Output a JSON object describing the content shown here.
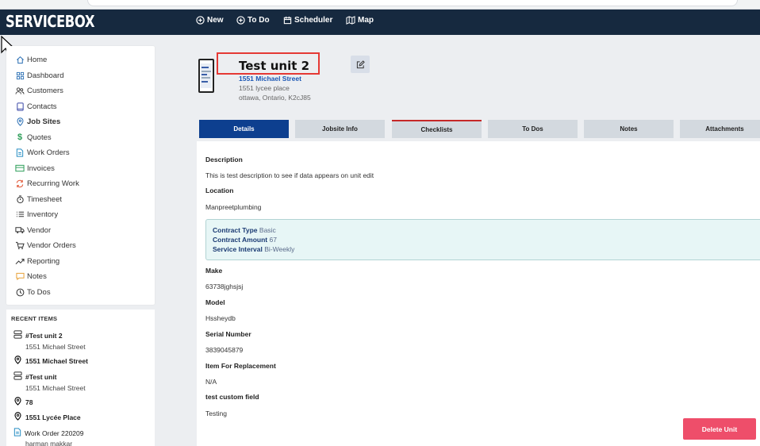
{
  "app": {
    "logo": "SERVICEBOX"
  },
  "nav": [
    {
      "label": "New",
      "icon": "plus-circle-icon"
    },
    {
      "label": "To Do",
      "icon": "plus-circle-icon"
    },
    {
      "label": "Scheduler",
      "icon": "calendar-icon"
    },
    {
      "label": "Map",
      "icon": "map-icon"
    }
  ],
  "sidebar": {
    "items": [
      {
        "label": "Home",
        "icon": "home-icon"
      },
      {
        "label": "Dashboard",
        "icon": "grid-icon"
      },
      {
        "label": "Customers",
        "icon": "users-icon"
      },
      {
        "label": "Contacts",
        "icon": "contact-book-icon"
      },
      {
        "label": "Job Sites",
        "icon": "location-pin-icon"
      },
      {
        "label": "Quotes",
        "icon": "dollar-icon"
      },
      {
        "label": "Work Orders",
        "icon": "document-icon"
      },
      {
        "label": "Invoices",
        "icon": "invoice-icon"
      },
      {
        "label": "Recurring Work",
        "icon": "recurring-icon"
      },
      {
        "label": "Timesheet",
        "icon": "stopwatch-icon"
      },
      {
        "label": "Inventory",
        "icon": "list-icon"
      },
      {
        "label": "Vendor",
        "icon": "truck-icon"
      },
      {
        "label": "Vendor Orders",
        "icon": "cart-icon"
      },
      {
        "label": "Reporting",
        "icon": "trend-icon"
      },
      {
        "label": "Notes",
        "icon": "note-icon"
      },
      {
        "label": "To Dos",
        "icon": "clock-icon"
      }
    ],
    "active_index": 4
  },
  "recent": {
    "title": "RECENT ITEMS",
    "items": [
      {
        "label": "#Test unit 2",
        "sub": "1551 Michael Street",
        "icon": "server-icon"
      },
      {
        "label": "1551 Michael Street",
        "sub": "",
        "icon": "location-pin-icon"
      },
      {
        "label": "#Test unit",
        "sub": "1551 Michael Street",
        "icon": "server-icon"
      },
      {
        "label": "78",
        "sub": "",
        "icon": "location-pin-icon"
      },
      {
        "label": "1551 Lycée Place",
        "sub": "",
        "icon": "location-pin-icon"
      },
      {
        "label": "Work Order 220209",
        "sub": "harman makkar",
        "icon": "document-icon"
      }
    ]
  },
  "unit": {
    "title": "Test unit 2",
    "link": "1551 Michael Street",
    "address1": "1551 lycee place",
    "address2": "ottawa, Ontario, K2cJ85"
  },
  "tabs": [
    "Details",
    "Jobsite Info",
    "Checklists",
    "To Dos",
    "Notes",
    "Attachments"
  ],
  "details": {
    "description_label": "Description",
    "description": "This is test description to see if data appears on unit edit",
    "location_label": "Location",
    "location": "Manpreetplumbing",
    "contract": {
      "type_label": "Contract Type",
      "type": "Basic",
      "amount_label": "Contract Amount",
      "amount": "67",
      "interval_label": "Service Interval",
      "interval": "Bi-Weekly"
    },
    "make_label": "Make",
    "make": "63738jghsjsj",
    "model_label": "Model",
    "model": "Hssheydb",
    "serial_label": "Serial Number",
    "serial": "3839045879",
    "replacement_label": "Item For Replacement",
    "replacement": "N/A",
    "custom_label": "test custom field",
    "custom": "Testing"
  },
  "actions": {
    "delete": "Delete Unit"
  },
  "colors": {
    "topbar": "#16293f",
    "active_tab": "#0d3f8f",
    "link": "#1a56b4",
    "delete": "#ee4e6a",
    "highlight": "#e53935"
  }
}
